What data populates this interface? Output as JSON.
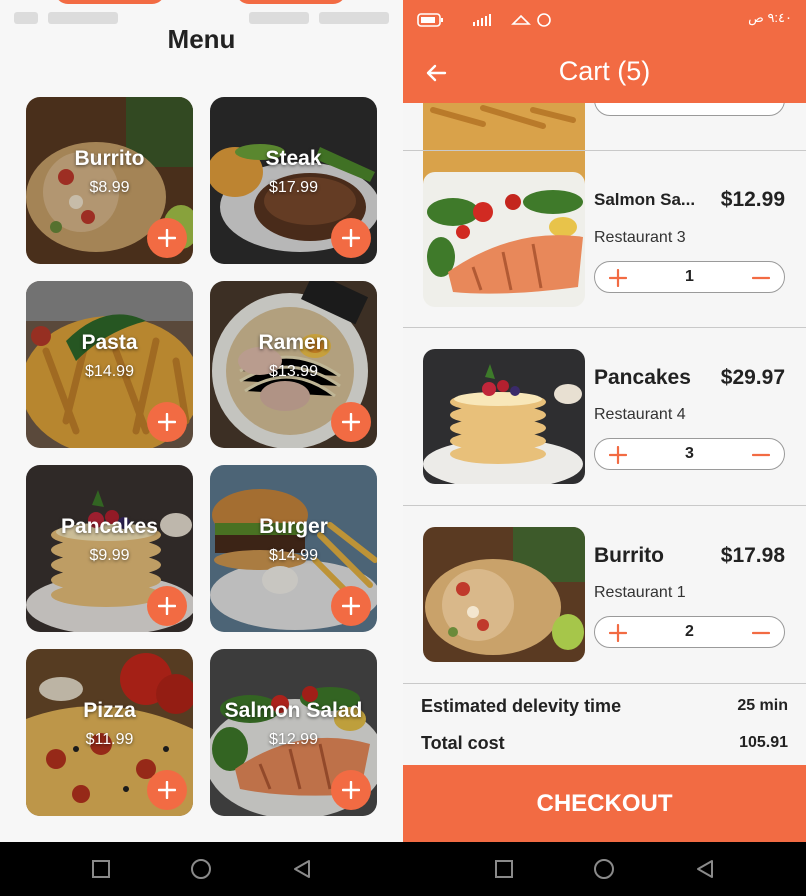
{
  "menu": {
    "title": "Menu",
    "items": [
      {
        "name": "Burrito",
        "price": "$8.99"
      },
      {
        "name": "Steak",
        "price": "$17.99"
      },
      {
        "name": "Pasta",
        "price": "$14.99"
      },
      {
        "name": "Ramen",
        "price": "$13.99"
      },
      {
        "name": "Pancakes",
        "price": "$9.99"
      },
      {
        "name": "Burger",
        "price": "$14.99"
      },
      {
        "name": "Pizza",
        "price": "$11.99"
      },
      {
        "name": "Salmon Salad",
        "price": "$12.99"
      }
    ]
  },
  "status": {
    "time": "٩:٤٠ ص"
  },
  "cart": {
    "title": "Cart (5)",
    "items": [
      {
        "name": "Salmon Sa...",
        "price": "$12.99",
        "restaurant": "Restaurant 3",
        "qty": "1"
      },
      {
        "name": "Pancakes",
        "price": "$29.97",
        "restaurant": "Restaurant 4",
        "qty": "3"
      },
      {
        "name": "Burrito",
        "price": "$17.98",
        "restaurant": "Restaurant 1",
        "qty": "2"
      }
    ],
    "delivery_label": "Estimated delevity time",
    "delivery_value": "25 min",
    "total_label": "Total cost",
    "total_value": "105.91",
    "checkout_label": "CHECKOUT"
  },
  "colors": {
    "accent": "#f26b43"
  }
}
